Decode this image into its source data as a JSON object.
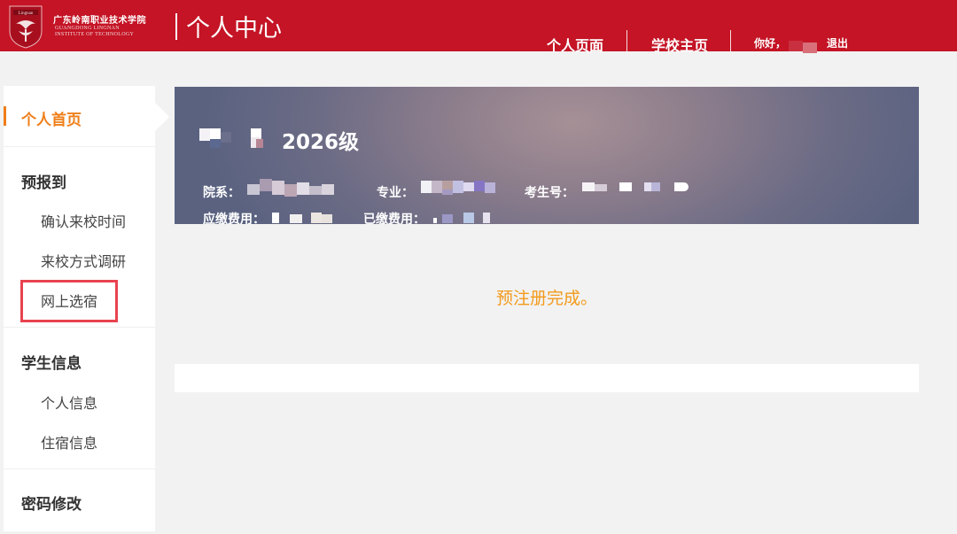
{
  "header": {
    "school_name_cn": "广东岭南职业技术学院",
    "school_name_en_line1": "GUANGDONG LINGNAN",
    "school_name_en_line2": "INSTITUTE OF TECHNOLOGY",
    "logo_text": "Lingnan",
    "title": "个人中心",
    "nav": {
      "personal_page": "个人页面",
      "school_home": "学校主页"
    },
    "greeting": "你好，",
    "logout": "退出",
    "colors": {
      "brand_red": "#c41425"
    }
  },
  "sidebar": {
    "home": "个人首页",
    "sections": [
      {
        "heading": "预报到",
        "items": [
          "确认来校时间",
          "来校方式调研",
          "网上选宿"
        ]
      },
      {
        "heading": "学生信息",
        "items": [
          "个人信息",
          "住宿信息"
        ]
      },
      {
        "heading": "密码修改",
        "items": []
      }
    ],
    "colors": {
      "active": "#ef7f1a",
      "highlight_box": "#e8434f"
    }
  },
  "profile": {
    "grade": "2026级",
    "department_label": "院系：",
    "major_label": "专业：",
    "exam_no_label": "考生号：",
    "fee_due_label": "应缴费用：",
    "fee_paid_label": "已缴费用："
  },
  "status_message": "预注册完成。",
  "colors": {
    "status_text": "#f39a1c"
  }
}
